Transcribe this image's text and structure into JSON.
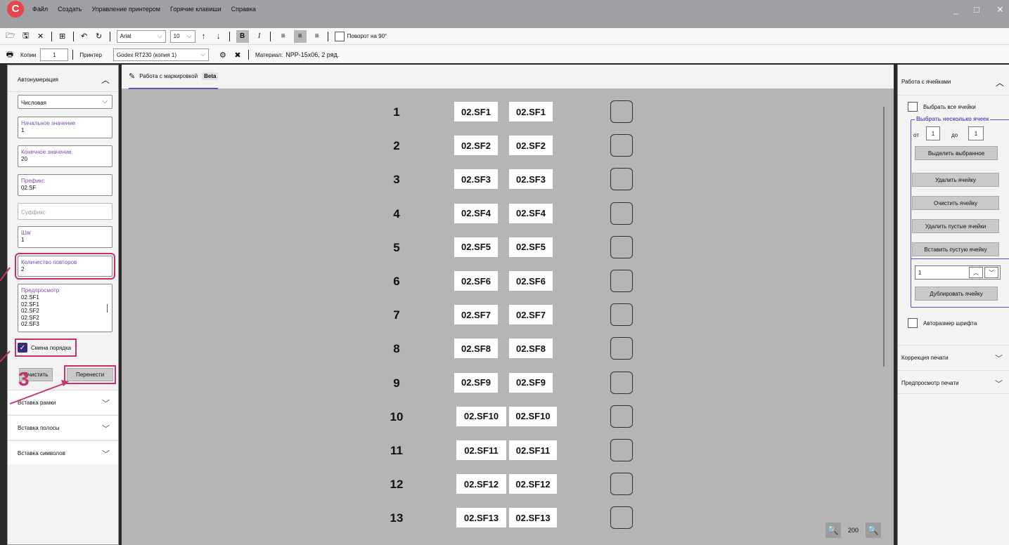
{
  "app": {
    "logo": "C",
    "menu": [
      "Файл",
      "Создать",
      "Управление принтером",
      "Горячие клавиши",
      "Справка"
    ],
    "win_controls": [
      "_",
      "□",
      "✕"
    ]
  },
  "toolbar1": {
    "font": "Arial",
    "size": "10",
    "rotate_label": "Поворот на 90°",
    "icons": [
      "open-folder-icon",
      "save-icon",
      "close-icon",
      "grid-icon",
      "undo-icon",
      "redo-icon",
      "arrow-up-icon",
      "arrow-down-icon",
      "bold-icon",
      "italic-icon",
      "align-left-icon",
      "align-center-icon",
      "align-right-icon"
    ]
  },
  "toolbar2": {
    "copies_label": "Копии",
    "copies_value": "1",
    "printer_label": "Принтер",
    "printer_value": "Godex RT230 (копия 1)",
    "material_label": "Материал:",
    "material_value": "NPP-15x06, 2 ряд."
  },
  "left": {
    "title": "Автонумерация",
    "type": "Числовая",
    "start": {
      "label": "Начальное значение",
      "value": "1"
    },
    "end": {
      "label": "Конечное значение",
      "value": "20"
    },
    "prefix": {
      "label": "Префикс",
      "value": "02.SF"
    },
    "suffix": {
      "placeholder": "Суффикс"
    },
    "step": {
      "label": "Шаг",
      "value": "1"
    },
    "repeats": {
      "label": "Количество повторов",
      "value": "2"
    },
    "preview": {
      "label": "Предпросмотр",
      "items": [
        "02.SF1",
        "02.SF1",
        "02.SF2",
        "02.SF2",
        "02.SF3"
      ]
    },
    "order_label": "Смена порядка",
    "clear_label": "Очистить",
    "move_label": "Перенести",
    "step_badge": "3",
    "sections": [
      "Вставка рамки",
      "Вставка полосы",
      "Вставка символов"
    ]
  },
  "center": {
    "tab_label": "Работа с маркировкой",
    "beta": "Beta",
    "rows": [
      {
        "n": "1",
        "a": "02.SF1",
        "b": "02.SF1"
      },
      {
        "n": "2",
        "a": "02.SF2",
        "b": "02.SF2"
      },
      {
        "n": "3",
        "a": "02.SF3",
        "b": "02.SF3"
      },
      {
        "n": "4",
        "a": "02.SF4",
        "b": "02.SF4"
      },
      {
        "n": "5",
        "a": "02.SF5",
        "b": "02.SF5"
      },
      {
        "n": "6",
        "a": "02.SF6",
        "b": "02.SF6"
      },
      {
        "n": "7",
        "a": "02.SF7",
        "b": "02.SF7"
      },
      {
        "n": "8",
        "a": "02.SF8",
        "b": "02.SF8"
      },
      {
        "n": "9",
        "a": "02.SF9",
        "b": "02.SF9"
      },
      {
        "n": "10",
        "a": "02.SF10",
        "b": "02.SF10"
      },
      {
        "n": "11",
        "a": "02.SF11",
        "b": "02.SF11"
      },
      {
        "n": "12",
        "a": "02.SF12",
        "b": "02.SF12"
      },
      {
        "n": "13",
        "a": "02.SF13",
        "b": "02.SF13"
      }
    ],
    "zoom": "200"
  },
  "right": {
    "title": "Работа с ячейками",
    "select_all": "Выбрать все ячейки",
    "select_multi": "Выбрать несколько ячеек",
    "from_label": "от",
    "from_value": "1",
    "to_label": "до",
    "to_value": "1",
    "select_btn": "Выделить выбранное",
    "delete_cell": "Удалить ячейку",
    "clear_cell": "Очистить ячейку",
    "delete_empty": "Удалить пустые ячейки",
    "insert_empty": "Вставить пустую ячейку",
    "dup_count": "1",
    "duplicate": "Дублировать ячейку",
    "autosize": "Авторазмер шрифта",
    "sections": [
      "Коррекция печати",
      "Предпросмотр печати"
    ]
  }
}
